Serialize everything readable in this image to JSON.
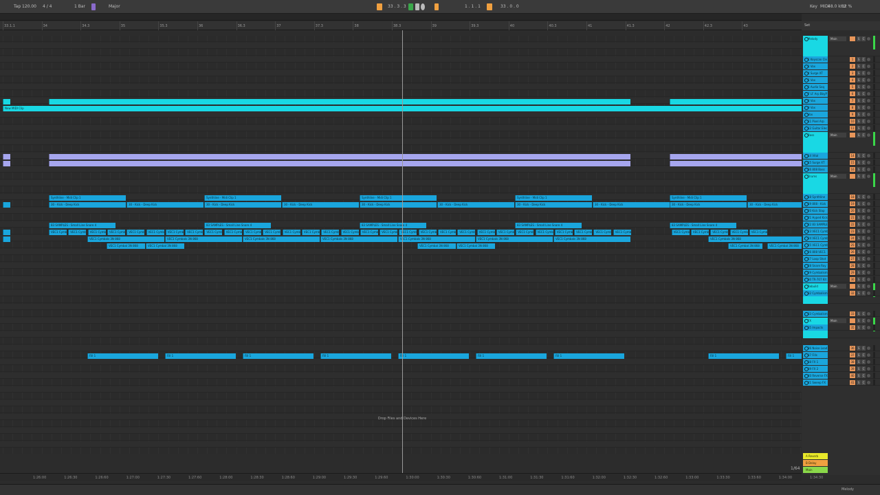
{
  "topbar": {
    "tap": "Tap",
    "tempo": "120.00",
    "signature": "4 / 4",
    "quant": "1 Bar",
    "key": "Major",
    "position": "33 . 3 . 3",
    "loop_start": "1 . 1 . 1",
    "loop_len": "33 . 0 . 0",
    "key_map": "Key",
    "midi": "MIDI",
    "cpu": "48.0 kHz",
    "cpu_pct": "12 %"
  },
  "ruler": {
    "bars": [
      "33.1.1",
      "34",
      "34.3",
      "35",
      "35.3",
      "36",
      "36.3",
      "37",
      "37.3",
      "38",
      "38.3",
      "39",
      "39.3",
      "40",
      "40.3",
      "41",
      "41.3",
      "42",
      "42.3",
      "43"
    ],
    "set": "Set"
  },
  "time_ruler": {
    "labels": [
      "1:26:00",
      "1:26:30",
      "1:26:60",
      "1:27:00",
      "1:27:30",
      "1:27:60",
      "1:28:00",
      "1:28:30",
      "1:28:60",
      "1:29:00",
      "1:29:30",
      "1:29:60",
      "1:30:00",
      "1:30:30",
      "1:30:60",
      "1:31:00",
      "1:31:30",
      "1:31:60",
      "1:32:00",
      "1:32:30",
      "1:32:60",
      "1:33:00",
      "1:33:30",
      "1:33:60",
      "1:34:00",
      "1:34:30"
    ]
  },
  "drop_text": "Drop Files and Devices Here",
  "zoom": "1/64",
  "clips": {
    "new_midi": "New MIDI Clip",
    "synth_midi": "Synthline - Midi Clip 1",
    "kick": "30 - Kick - Deep Kick",
    "snare": "83 SAMPLES - Small Line Snare 4",
    "vec_cymbal": "VEC1 Cymbal",
    "cymbal_b": "VEC1 Cymbals 3N 868",
    "cymbal_c": "VEC1 Cymbal 3N 868",
    "fill": "Fill 1"
  },
  "tracks": [
    {
      "name": "Melody",
      "num": "",
      "group": true
    },
    {
      "name": "1 Keyscan Cle",
      "num": "1"
    },
    {
      "name": "2 Vox",
      "num": "2"
    },
    {
      "name": "4 Surge XT",
      "num": "3"
    },
    {
      "name": "5 Vox",
      "num": "4"
    },
    {
      "name": "6 Audio Seq",
      "num": "5"
    },
    {
      "name": "7 LF Arp BbyP",
      "num": "6"
    },
    {
      "name": "8 Vox",
      "num": "7"
    },
    {
      "name": "9 Vox",
      "num": "8"
    },
    {
      "name": "Vox",
      "num": "9"
    },
    {
      "name": "11 Pixel Arp",
      "num": "10"
    },
    {
      "name": "12 Guitar Elec",
      "num": "11"
    },
    {
      "name": "Bass",
      "num": "",
      "group": true
    },
    {
      "name": "14 Vital",
      "num": "14"
    },
    {
      "name": "15 Surge XT",
      "num": "15"
    },
    {
      "name": "16 808 Bass",
      "num": "16"
    },
    {
      "name": "Drums",
      "num": "",
      "group": true
    },
    {
      "name": "18 Synthline",
      "num": "18"
    },
    {
      "name": "19 808 - Kick",
      "num": "19"
    },
    {
      "name": "20 Kick Slap",
      "num": "20"
    },
    {
      "name": "21 Hyped Kick",
      "num": "21"
    },
    {
      "name": "22 83 SAMPLE",
      "num": "22"
    },
    {
      "name": "23 VEC1 Cymb",
      "num": "23"
    },
    {
      "name": "24 VEC1 Cymb",
      "num": "24"
    },
    {
      "name": "25 VEC1 Cymb",
      "num": "25"
    },
    {
      "name": "26 808 VEC1",
      "num": "26"
    },
    {
      "name": "27 Loop Shot",
      "num": "27"
    },
    {
      "name": "28 Snare Roy",
      "num": "28"
    },
    {
      "name": "29 Cymbalism",
      "num": "29"
    },
    {
      "name": "30 TR-707 Kit",
      "num": "30"
    },
    {
      "name": "Rebuild",
      "num": "",
      "group": true
    },
    {
      "name": "32 Cymbalism",
      "num": "32"
    },
    {
      "name": "33 Cymbalism",
      "num": "33"
    },
    {
      "name": "FX",
      "num": "",
      "group": true
    },
    {
      "name": "35 Impacts",
      "num": "35"
    },
    {
      "name": "36 Noise Lead",
      "num": "36"
    },
    {
      "name": "37 Fills",
      "num": "37"
    },
    {
      "name": "38 FX 1",
      "num": "38"
    },
    {
      "name": "39 FX 2",
      "num": "39"
    },
    {
      "name": "40 Reverse FX",
      "num": "40"
    },
    {
      "name": "41 Sweep FX",
      "num": "41"
    }
  ],
  "returns": [
    {
      "name": "A Reverb",
      "color": "#e8e82a"
    },
    {
      "name": "B Delay",
      "color": "#f0a040"
    },
    {
      "name": "Main",
      "color": "#8ad84a"
    }
  ],
  "group_input": "Main",
  "status_track": "Melody"
}
